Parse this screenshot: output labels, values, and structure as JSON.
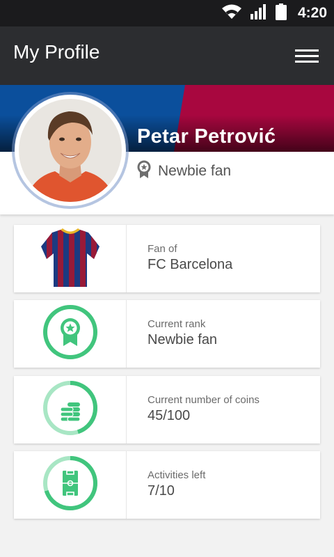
{
  "status_bar": {
    "time": "4:20",
    "icons": [
      "wifi-icon",
      "signal-icon",
      "battery-icon"
    ]
  },
  "header": {
    "title": "My Profile",
    "menu_icon": "hamburger-menu-icon"
  },
  "profile": {
    "name": "Petar Petrović",
    "rank": "Newbie fan",
    "rank_icon": "medal-icon",
    "banner_colors": {
      "left": "#0b4f9c",
      "right": "#a8073f"
    }
  },
  "cards": [
    {
      "label": "Fan of",
      "value": "FC Barcelona",
      "icon": "jersey-icon"
    },
    {
      "label": "Current rank",
      "value": "Newbie fan",
      "icon": "rank-medal-icon"
    },
    {
      "label": "Current number of coins",
      "value": "45/100",
      "icon": "coins-icon",
      "progress": 0.45
    },
    {
      "label": "Activities left",
      "value": "7/10",
      "icon": "football-pitch-icon",
      "progress": 0.7
    }
  ],
  "colors": {
    "accent": "#41c57d",
    "accent_light": "#a8e6c4",
    "app_bar": "#2c2d30",
    "status_bar": "#1b1b1d"
  }
}
